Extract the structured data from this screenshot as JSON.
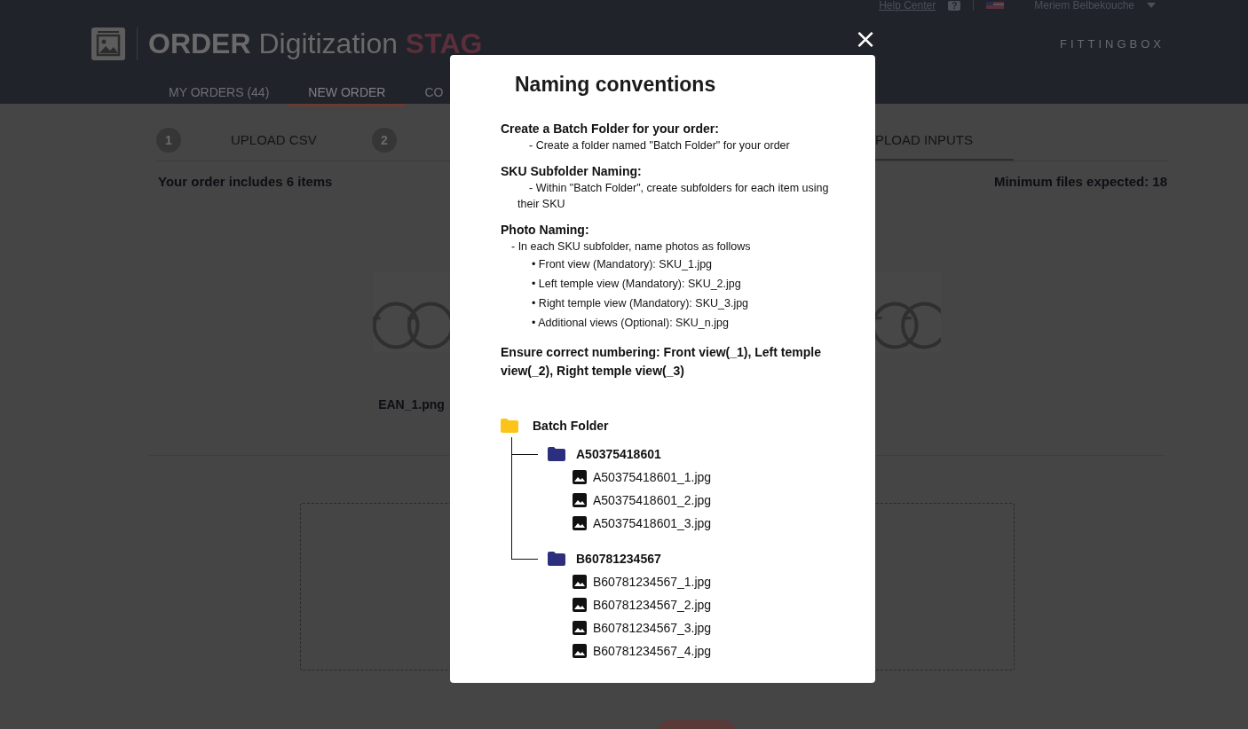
{
  "header": {
    "help_link": "Help Center",
    "help_badge": "?",
    "user_name": "Meriem Belbekouche",
    "app_title": {
      "prefix": "ORDER",
      "name": "Digitization",
      "env": "STAG"
    },
    "brand": "FITTINGBOX"
  },
  "tabs": [
    {
      "label": "MY ORDERS (44)",
      "selected": false
    },
    {
      "label": "NEW ORDER",
      "selected": true
    },
    {
      "label": "CO",
      "selected": false
    }
  ],
  "steps": [
    {
      "number": "1",
      "label": "UPLOAD CSV",
      "selected": false
    },
    {
      "number": "2",
      "selected": false
    },
    {
      "label": "PLOAD INPUTS",
      "selected": true
    }
  ],
  "summary": {
    "items_text": "Your order includes 6 items",
    "min_files_text": "Minimum files expected: 18"
  },
  "products": [
    {
      "kind": "picture",
      "caption": "EAN_1.png"
    },
    {
      "kind": "picture"
    }
  ],
  "modal": {
    "close": "×",
    "title": "Naming conventions",
    "sections": [
      {
        "heading": "Create a Batch Folder for your order:",
        "lines": [
          {
            "kind": "dash",
            "text": "- Create a folder named \"Batch Folder\" for your order"
          }
        ]
      },
      {
        "heading": "SKU Subfolder Naming:",
        "lines": [
          {
            "kind": "dash",
            "text": "- Within \"Batch Folder\", create subfolders for each item using their SKU"
          }
        ]
      },
      {
        "heading": "Photo Naming:",
        "lines": [
          {
            "kind": "intro",
            "text": "- In each SKU subfolder, name photos as follows"
          },
          {
            "kind": "bullet",
            "text": "• Front view (Mandatory): SKU_1.jpg"
          },
          {
            "kind": "bullet",
            "text": "• Left temple view (Mandatory): SKU_2.jpg"
          },
          {
            "kind": "bullet",
            "text": "• Right temple view (Mandatory): SKU_3.jpg"
          },
          {
            "kind": "bullet",
            "text": "• Additional views (Optional): SKU_n.jpg"
          }
        ]
      },
      {
        "heading": "Ensure correct numbering: Front view(_1), Left temple view(_2), Right temple view(_3)"
      }
    ],
    "tree": {
      "kind": "root",
      "name": "Batch Folder",
      "children": [
        {
          "kind": "folder",
          "name": "A50375418601",
          "children": [
            {
              "kind": "file",
              "name": "A50375418601_1.jpg"
            },
            {
              "kind": "file",
              "name": "A50375418601_2.jpg"
            },
            {
              "kind": "file",
              "name": "A50375418601_3.jpg"
            }
          ]
        },
        {
          "kind": "folder",
          "name": "B60781234567",
          "children": [
            {
              "kind": "file",
              "name": "B60781234567_1.jpg"
            },
            {
              "kind": "file",
              "name": "B60781234567_2.jpg"
            },
            {
              "kind": "file",
              "name": "B60781234567_3.jpg"
            },
            {
              "kind": "file",
              "name": "B60781234567_4.jpg"
            }
          ]
        }
      ]
    }
  }
}
